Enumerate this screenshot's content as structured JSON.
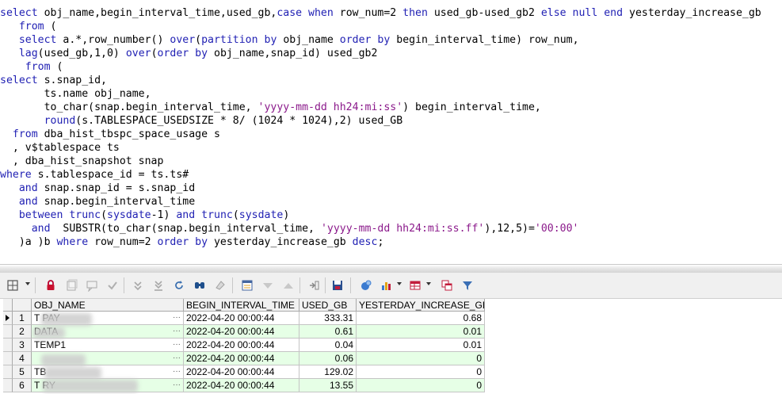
{
  "sql_lines": [
    [
      [
        "kw",
        "select"
      ],
      [
        "pl",
        " obj_name,begin_interval_time,used_gb,"
      ],
      [
        "kw",
        "case when"
      ],
      [
        "pl",
        " row_num=2 "
      ],
      [
        "kw",
        "then"
      ],
      [
        "pl",
        " used_gb-used_gb2 "
      ],
      [
        "kw",
        "else null end"
      ],
      [
        "pl",
        " yesterday_increase_gb"
      ]
    ],
    [
      [
        "pl",
        "   "
      ],
      [
        "kw",
        "from"
      ],
      [
        "pl",
        " ("
      ]
    ],
    [
      [
        "pl",
        "   "
      ],
      [
        "kw",
        "select"
      ],
      [
        "pl",
        " a.*,row_number() "
      ],
      [
        "kw",
        "over"
      ],
      [
        "pl",
        "("
      ],
      [
        "kw",
        "partition by"
      ],
      [
        "pl",
        " obj_name "
      ],
      [
        "kw",
        "order by"
      ],
      [
        "pl",
        " begin_interval_time) row_num,"
      ]
    ],
    [
      [
        "pl",
        "   "
      ],
      [
        "fn",
        "lag"
      ],
      [
        "pl",
        "(used_gb,1,0) "
      ],
      [
        "kw",
        "over"
      ],
      [
        "pl",
        "("
      ],
      [
        "kw",
        "order by"
      ],
      [
        "pl",
        " obj_name,snap_id) used_gb2"
      ]
    ],
    [
      [
        "pl",
        "    "
      ],
      [
        "kw",
        "from"
      ],
      [
        "pl",
        " ("
      ]
    ],
    [
      [
        "kw",
        "select"
      ],
      [
        "pl",
        " s.snap_id,"
      ]
    ],
    [
      [
        "pl",
        "       ts.name obj_name,"
      ]
    ],
    [
      [
        "pl",
        "       to_char(snap.begin_interval_time, "
      ],
      [
        "str",
        "'yyyy-mm-dd hh24:mi:ss'"
      ],
      [
        "pl",
        ") begin_interval_time,"
      ]
    ],
    [
      [
        "pl",
        "       "
      ],
      [
        "fn",
        "round"
      ],
      [
        "pl",
        "(s.TABLESPACE_USEDSIZE * 8/ (1024 * 1024),2) used_GB"
      ]
    ],
    [
      [
        "pl",
        "  "
      ],
      [
        "kw",
        "from"
      ],
      [
        "pl",
        " dba_hist_tbspc_space_usage s"
      ]
    ],
    [
      [
        "pl",
        "  , v$tablespace ts"
      ]
    ],
    [
      [
        "pl",
        "  , dba_hist_snapshot snap"
      ]
    ],
    [
      [
        "kw",
        "where"
      ],
      [
        "pl",
        " s.tablespace_id = ts.ts#"
      ]
    ],
    [
      [
        "pl",
        "   "
      ],
      [
        "kw",
        "and"
      ],
      [
        "pl",
        " snap.snap_id = s.snap_id"
      ]
    ],
    [
      [
        "pl",
        "   "
      ],
      [
        "kw",
        "and"
      ],
      [
        "pl",
        " snap.begin_interval_time"
      ]
    ],
    [
      [
        "pl",
        "   "
      ],
      [
        "kw",
        "between"
      ],
      [
        "pl",
        " "
      ],
      [
        "fn",
        "trunc"
      ],
      [
        "pl",
        "("
      ],
      [
        "fn",
        "sysdate"
      ],
      [
        "pl",
        "-1) "
      ],
      [
        "kw",
        "and"
      ],
      [
        "pl",
        " "
      ],
      [
        "fn",
        "trunc"
      ],
      [
        "pl",
        "("
      ],
      [
        "fn",
        "sysdate"
      ],
      [
        "pl",
        ")"
      ]
    ],
    [
      [
        "pl",
        "     "
      ],
      [
        "kw",
        "and"
      ],
      [
        "pl",
        "  SUBSTR(to_char(snap.begin_interval_time, "
      ],
      [
        "str",
        "'yyyy-mm-dd hh24:mi:ss.ff'"
      ],
      [
        "pl",
        "),12,5)="
      ],
      [
        "str",
        "'00:00'"
      ]
    ],
    [
      [
        "pl",
        "   )a )b "
      ],
      [
        "kw",
        "where"
      ],
      [
        "pl",
        " row_num=2 "
      ],
      [
        "kw",
        "order by"
      ],
      [
        "pl",
        " yesterday_increase_gb "
      ],
      [
        "kw",
        "desc"
      ],
      [
        "pl",
        ";"
      ]
    ]
  ],
  "grid": {
    "columns": [
      "OBJ_NAME",
      "BEGIN_INTERVAL_TIME",
      "USED_GB",
      "YESTERDAY_INCREASE_GB"
    ],
    "rows": [
      {
        "num": "1",
        "obj_name": "T          PAY",
        "time": "2022-04-20 00:00:44",
        "used": "333.31",
        "inc": "0.68",
        "current": true
      },
      {
        "num": "2",
        "obj_name": "       DATA",
        "time": "2022-04-20 00:00:44",
        "used": "0.61",
        "inc": "0.01",
        "current": false
      },
      {
        "num": "3",
        "obj_name": "TEMP1",
        "time": "2022-04-20 00:00:44",
        "used": "0.04",
        "inc": "0.01",
        "current": false
      },
      {
        "num": "4",
        "obj_name": "",
        "time": "2022-04-20 00:00:44",
        "used": "0.06",
        "inc": "0",
        "current": false
      },
      {
        "num": "5",
        "obj_name": "TB",
        "time": "2022-04-20 00:00:44",
        "used": "129.02",
        "inc": "0",
        "current": false
      },
      {
        "num": "6",
        "obj_name": "T              RY",
        "time": "2022-04-20 00:00:44",
        "used": "13.55",
        "inc": "0",
        "current": false
      }
    ],
    "cell_ellipsis": "···",
    "row_colors": {
      "odd": "#ffffff",
      "even": "#e6ffe6"
    }
  },
  "toolbar_icons": [
    "grid-options-icon",
    "lock-icon",
    "new-record-icon",
    "delete-record-icon",
    "post-icon",
    "filter-down-icon",
    "filter-all-icon",
    "refresh-icon",
    "find-icon",
    "clear-icon",
    "query-by-example-icon",
    "sort-desc-icon",
    "sort-asc-icon",
    "export-icon",
    "save-icon",
    "link-icon",
    "chart-icon",
    "table-icon",
    "compare-icon",
    "funnel-icon"
  ]
}
